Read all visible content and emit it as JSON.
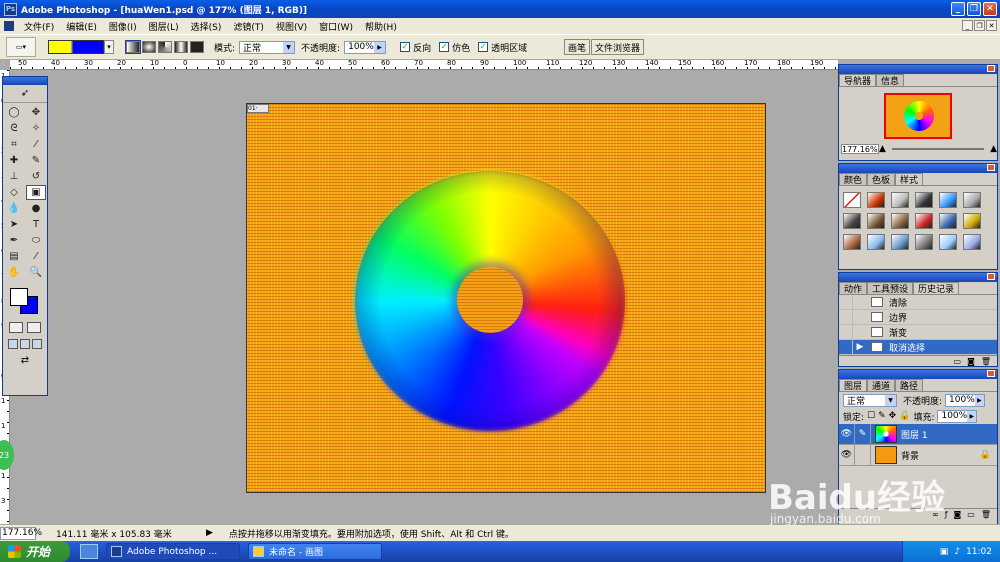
{
  "app": {
    "title": "Adobe Photoshop - [huaWen1.psd @ 177% (图层 1, RGB)]"
  },
  "menu": [
    "文件(F)",
    "编辑(E)",
    "图像(I)",
    "图层(L)",
    "选择(S)",
    "滤镜(T)",
    "视图(V)",
    "窗口(W)",
    "帮助(H)"
  ],
  "options": {
    "mode_label": "模式:",
    "mode_value": "正常",
    "opacity_label": "不透明度:",
    "opacity_value": "100%",
    "reverse_label": "反向",
    "dither_label": "仿色",
    "transparency_label": "透明区域",
    "gradient_colors": [
      "#ffff00",
      "#0000ff"
    ]
  },
  "palette_well": [
    "画笔",
    "文件浏览器"
  ],
  "ruler": {
    "top_ticks": [
      "50",
      "40",
      "30",
      "20",
      "10",
      "0",
      "10",
      "20",
      "30",
      "40",
      "50",
      "60",
      "70",
      "80",
      "90",
      "100",
      "110",
      "120",
      "130",
      "140",
      "150",
      "160",
      "170",
      "180",
      "190"
    ],
    "left_ticks": [
      "1",
      "0",
      "1",
      "2",
      "3",
      "4",
      "5",
      "6",
      "7",
      "8",
      "9",
      "1",
      "0",
      "1",
      "1",
      "2",
      "1",
      "3"
    ]
  },
  "document": {
    "tab_label": "01·",
    "background_color": "#f3a215"
  },
  "navigator": {
    "tabs": [
      "导航器",
      "信息"
    ],
    "zoom": "177.16%"
  },
  "color_panel": {
    "tabs": [
      "颜色",
      "色板",
      "样式"
    ],
    "styles": [
      "#ffffff",
      "#cc3300",
      "#bbbbbb",
      "#333333",
      "#3399ff",
      "#aaaaaa",
      "#444444",
      "#775533",
      "#886644",
      "#cc2222",
      "#3366aa",
      "#ccaa00",
      "#aa6644",
      "#88bbee",
      "#6699cc",
      "#777777",
      "#99ccff",
      "#99aaee"
    ]
  },
  "history": {
    "tabs": [
      "动作",
      "工具预设",
      "历史记录"
    ],
    "items": [
      "清除",
      "边界",
      "渐变",
      "取消选择"
    ]
  },
  "layers": {
    "tabs": [
      "图层",
      "通道",
      "路径"
    ],
    "blend": "正常",
    "opacity_label": "不透明度:",
    "opacity": "100%",
    "lock_label": "锁定:",
    "fill_label": "填充:",
    "fill": "100%",
    "items": [
      {
        "name": "图层 1",
        "selected": true
      },
      {
        "name": "背景",
        "selected": false
      }
    ]
  },
  "status": {
    "zoom": "177.16%",
    "dims": "141.11 毫米 x 105.83 毫米",
    "tip": "点按并拖移以用渐变填充。要用附加选项，使用 Shift、Alt 和 Ctrl 键。"
  },
  "taskbar": {
    "start": "开始",
    "tasks": [
      "Adobe Photoshop ...",
      "未命名 - 画图"
    ],
    "clock": "11:02"
  },
  "overlay": {
    "badge": "23",
    "watermark": "Baidu经验",
    "watermark_url": "jingyan.baidu.com"
  }
}
